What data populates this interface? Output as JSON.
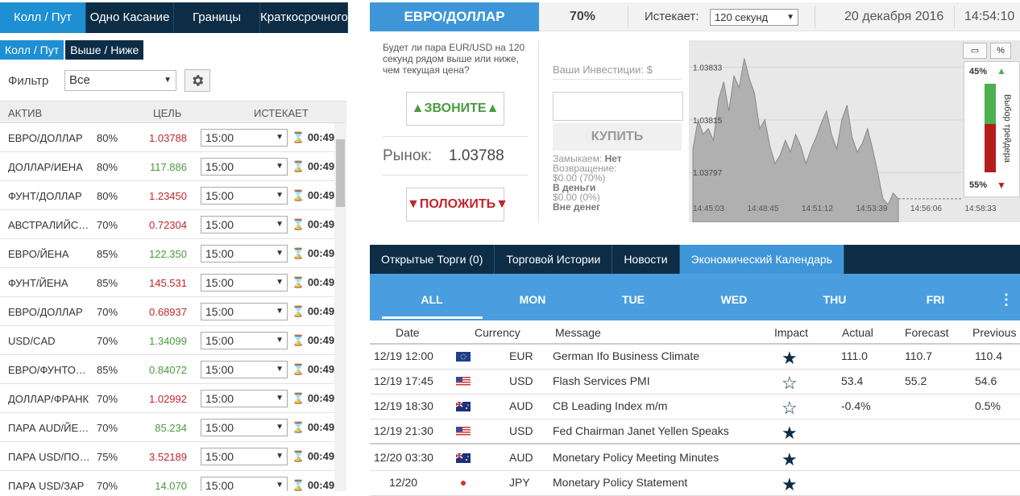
{
  "top_tabs": [
    "Колл / Пут",
    "Одно Касание",
    "Границы",
    "Краткосрочного"
  ],
  "sub_tabs": [
    "Колл / Пут",
    "Выше / Ниже"
  ],
  "filter": {
    "label": "Фильтр",
    "value": "Все"
  },
  "table_headers": {
    "asset": "АКТИВ",
    "target": "ЦЕЛЬ",
    "expires": "ИСТЕКАЕТ"
  },
  "assets": [
    {
      "name": "ЕВРО/ДОЛЛАР",
      "pct": "80%",
      "target": "1.03788",
      "dir": "dn",
      "expiry": "15:00",
      "time": "00:49"
    },
    {
      "name": "ДОЛЛАР/ИЕНА",
      "pct": "80%",
      "target": "117.886",
      "dir": "up",
      "expiry": "15:00",
      "time": "00:49"
    },
    {
      "name": "ФУНТ/ДОЛЛАР",
      "pct": "80%",
      "target": "1.23450",
      "dir": "dn",
      "expiry": "15:00",
      "time": "00:49"
    },
    {
      "name": "АВСТРАЛИЙСК…",
      "pct": "70%",
      "target": "0.72304",
      "dir": "dn",
      "expiry": "15:00",
      "time": "00:49"
    },
    {
      "name": "ЕВРО/ЙЕНА",
      "pct": "85%",
      "target": "122.350",
      "dir": "up",
      "expiry": "15:00",
      "time": "00:49"
    },
    {
      "name": "ФУНТ/ЙЕНА",
      "pct": "85%",
      "target": "145.531",
      "dir": "dn",
      "expiry": "15:00",
      "time": "00:49"
    },
    {
      "name": "ЕВРО/ДОЛЛАР",
      "pct": "70%",
      "target": "0.68937",
      "dir": "dn",
      "expiry": "15:00",
      "time": "00:49"
    },
    {
      "name": "USD/CAD",
      "pct": "70%",
      "target": "1.34099",
      "dir": "up",
      "expiry": "15:00",
      "time": "00:49"
    },
    {
      "name": "ЕВРО/ФУНТОВ …",
      "pct": "85%",
      "target": "0.84072",
      "dir": "up",
      "expiry": "15:00",
      "time": "00:49"
    },
    {
      "name": "ДОЛЛАР/ФРАНК",
      "pct": "70%",
      "target": "1.02992",
      "dir": "dn",
      "expiry": "15:00",
      "time": "00:49"
    },
    {
      "name": "ПАРА AUD/ЙЕНА",
      "pct": "70%",
      "target": "85.234",
      "dir": "up",
      "expiry": "15:00",
      "time": "00:49"
    },
    {
      "name": "ПАРА USD/ПОП…",
      "pct": "75%",
      "target": "3.52189",
      "dir": "dn",
      "expiry": "15:00",
      "time": "00:49"
    },
    {
      "name": "ПАРА USD/ЗАР",
      "pct": "70%",
      "target": "14.070",
      "dir": "up",
      "expiry": "15:00",
      "time": "00:49"
    }
  ],
  "trade": {
    "asset": "ЕВРО/ДОЛЛАР",
    "payout": "70%",
    "expires_label": "Истекает:",
    "expires_value": "120 секунд",
    "date": "20 декабря 2016",
    "time": "14:54:10",
    "question": "Будет ли пара EUR/USD на 120 секунд рядом выше или ниже, чем текущая цена?",
    "call_label": "ЗВОНИТЕ",
    "market_label": "Рынок:",
    "market_value": "1.03788",
    "put_label": "ПОЛОЖИТЬ",
    "investment_label": "Ваши Инвестиции: $",
    "buy_label": "КУПИТЬ",
    "lock_label": "Замыкаем:",
    "lock_value": "Нет",
    "return_label": "Возвращение:",
    "return_value": "$0.00 (70%)",
    "itm_label": "В деньги",
    "itm_value": "$0.00 (0%)",
    "otm_label": "Вне денег"
  },
  "chart_data": {
    "type": "area",
    "y_ticks": [
      "1.03833",
      "1.03815",
      "1.03797"
    ],
    "x_ticks": [
      "14:45:03",
      "14:48:45",
      "14:51:12",
      "14:53:39",
      "14:56:06",
      "14:58:33"
    ],
    "values": [
      1.03805,
      1.03815,
      1.0381,
      1.03812,
      1.03808,
      1.03822,
      1.03828,
      1.03818,
      1.0383,
      1.03826,
      1.03836,
      1.03829,
      1.03824,
      1.03812,
      1.03815,
      1.03806,
      1.038,
      1.03803,
      1.03808,
      1.03804,
      1.0381,
      1.03806,
      1.038,
      1.03805,
      1.03809,
      1.03814,
      1.03818,
      1.0381,
      1.03805,
      1.03815,
      1.0382,
      1.03809,
      1.03804,
      1.03807,
      1.03812,
      1.03805,
      1.03797,
      1.03788,
      1.03786,
      1.0379,
      1.03788
    ],
    "y_range": [
      1.0378,
      1.0384
    ],
    "sentiment": {
      "label": "Выбор трейдера",
      "up": "45%",
      "down": "55%",
      "up_color": "#4caf50",
      "down_color": "#b71c1c"
    }
  },
  "bottom_tabs": [
    "Открытые Торги (0)",
    "Торговой Истории",
    "Новости",
    "Экономический Календарь"
  ],
  "days": [
    "ALL",
    "MON",
    "TUE",
    "WED",
    "THU",
    "FRI"
  ],
  "calendar_headers": {
    "date": "Date",
    "currency": "Currency",
    "message": "Message",
    "impact": "Impact",
    "actual": "Actual",
    "forecast": "Forecast",
    "previous": "Previous"
  },
  "calendar": [
    {
      "date": "12/19 12:00",
      "flag": "eu",
      "currency": "EUR",
      "message": "German Ifo Business Climate",
      "impact": "high",
      "actual": "111.0",
      "forecast": "110.7",
      "previous": "110.4"
    },
    {
      "date": "12/19 17:45",
      "flag": "us",
      "currency": "USD",
      "message": "Flash Services PMI",
      "impact": "low",
      "actual": "53.4",
      "forecast": "55.2",
      "previous": "54.6"
    },
    {
      "date": "12/19 18:30",
      "flag": "au",
      "currency": "AUD",
      "message": "CB Leading Index m/m",
      "impact": "low",
      "actual": "-0.4%",
      "forecast": "",
      "previous": "0.5%"
    },
    {
      "date": "12/19 21:30",
      "flag": "us",
      "currency": "USD",
      "message": "Fed Chairman Janet Yellen Speaks",
      "impact": "high",
      "actual": "",
      "forecast": "",
      "previous": ""
    },
    {
      "date": "12/20 03:30",
      "flag": "au",
      "currency": "AUD",
      "message": "Monetary Policy Meeting Minutes",
      "impact": "high",
      "actual": "",
      "forecast": "",
      "previous": ""
    },
    {
      "date": "12/20",
      "flag": "jp",
      "currency": "JPY",
      "message": "Monetary Policy Statement",
      "impact": "high",
      "actual": "",
      "forecast": "",
      "previous": ""
    }
  ]
}
